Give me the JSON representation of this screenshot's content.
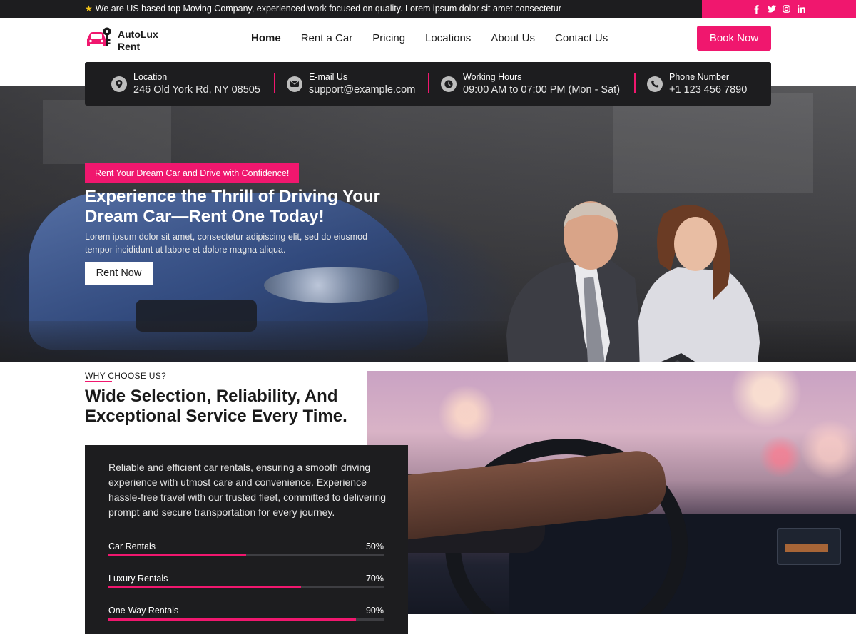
{
  "topbar": {
    "announcement": "We are US based top Moving Company, experienced work focused on quality. Lorem ipsum dolor sit amet consectetur",
    "social_icons": [
      "facebook-icon",
      "twitter-icon",
      "instagram-icon",
      "linkedin-icon"
    ]
  },
  "header": {
    "logo_line1": "AutoLux",
    "logo_line2": "Rent",
    "nav": [
      "Home",
      "Rent a Car",
      "Pricing",
      "Locations",
      "About Us",
      "Contact Us"
    ],
    "active_nav": "Home",
    "book_label": "Book Now"
  },
  "info": [
    {
      "label": "Location",
      "value": "246 Old York Rd, NY 08505",
      "icon": "location-pin-icon"
    },
    {
      "label": "E-mail Us",
      "value": "support@example.com",
      "icon": "mail-icon"
    },
    {
      "label": "Working Hours",
      "value": "09:00 AM to 07:00 PM (Mon - Sat)",
      "icon": "clock-icon"
    },
    {
      "label": "Phone Number",
      "value": "+1 123 456 7890",
      "icon": "phone-icon"
    }
  ],
  "hero": {
    "badge": "Rent Your Dream Car and Drive with Confidence!",
    "title": "Experience the Thrill of Driving Your Dream Car—Rent One Today!",
    "description": "Lorem ipsum dolor sit amet, consectetur adipiscing elit, sed do eiusmod tempor incididunt ut labore et dolore magna aliqua.",
    "cta": "Rent Now"
  },
  "why": {
    "label": "WHY CHOOSE US?",
    "title": "Wide Selection, Reliability, And Exceptional Service Every Time.",
    "description": "Reliable and efficient car rentals, ensuring a smooth driving experience with utmost care and convenience. Experience hassle-free travel with our trusted fleet, committed to delivering prompt and secure transportation for every journey.",
    "skills": [
      {
        "name": "Car Rentals",
        "percent_label": "50%",
        "value": 0.5
      },
      {
        "name": "Luxury Rentals",
        "percent_label": "70%",
        "value": 0.7
      },
      {
        "name": "One-Way Rentals",
        "percent_label": "90%",
        "value": 0.9
      }
    ]
  },
  "colors": {
    "accent": "#f0176e",
    "dark": "#1d1d1f"
  }
}
